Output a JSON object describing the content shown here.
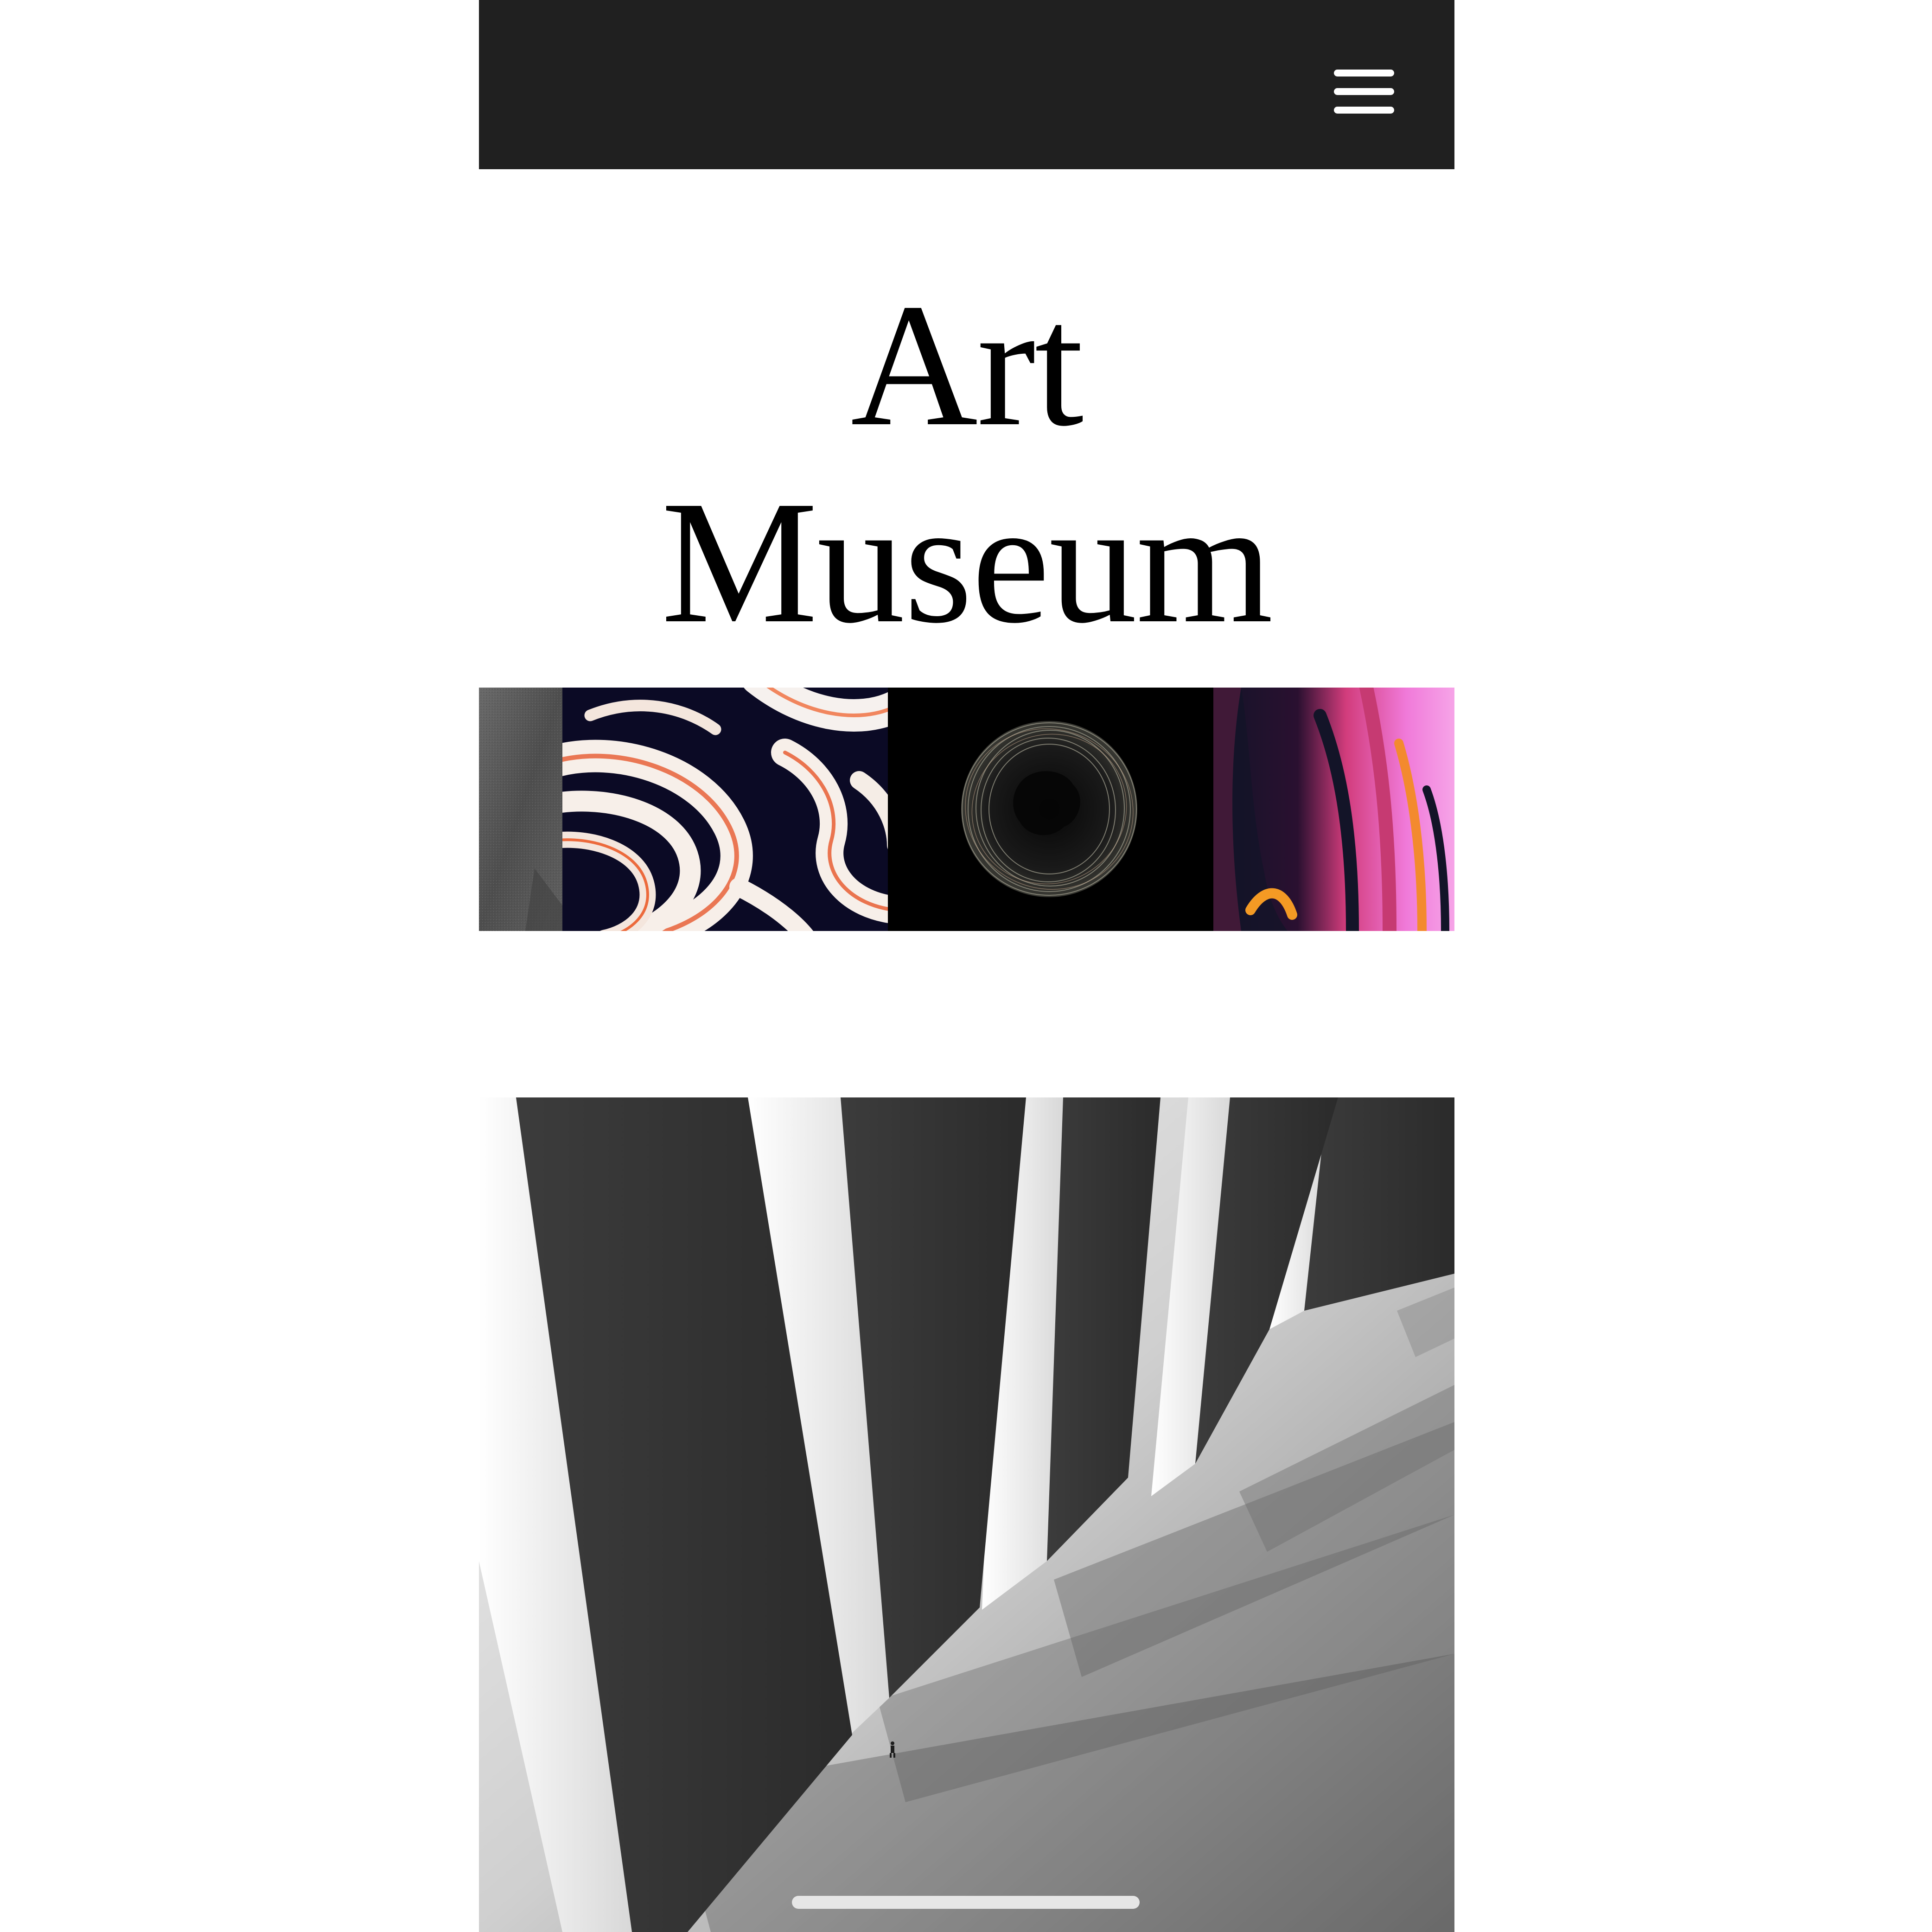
{
  "app": {
    "title_line_1": "Art",
    "title_line_2": "Museum"
  },
  "header": {
    "menu_icon": "hamburger-menu-icon",
    "background": "#202020"
  },
  "gallery_strip": {
    "items": [
      {
        "name": "gray-texture-artwork"
      },
      {
        "name": "swirl-artwork"
      },
      {
        "name": "wire-sphere-artwork"
      },
      {
        "name": "gradient-flow-artwork"
      }
    ]
  },
  "hero": {
    "name": "pillars-artwork"
  }
}
